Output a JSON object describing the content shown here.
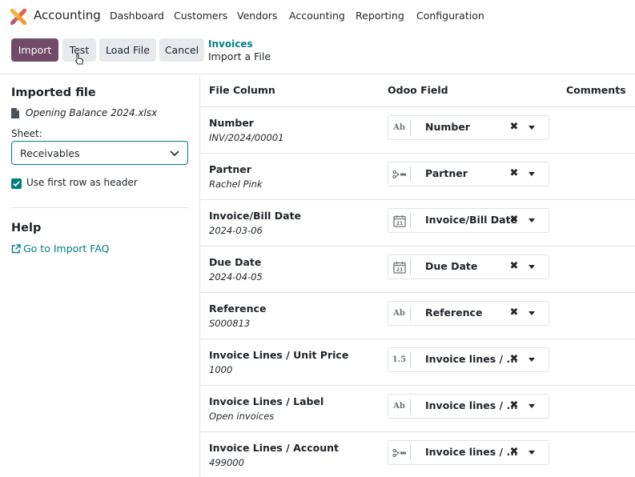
{
  "app": {
    "name": "Accounting",
    "logo_icon": "odoo-accounting-logo-icon"
  },
  "menu": [
    "Dashboard",
    "Customers",
    "Vendors",
    "Accounting",
    "Reporting",
    "Configuration"
  ],
  "toolbar": {
    "import_label": "Import",
    "test_label": "Test",
    "load_file_label": "Load File",
    "cancel_label": "Cancel"
  },
  "breadcrumb": {
    "parent": "Invoices",
    "current": "Import a File"
  },
  "sidebar": {
    "imported_file_title": "Imported file",
    "file_name": "Opening Balance 2024.xlsx",
    "sheet_label": "Sheet:",
    "sheet_value": "Receivables",
    "use_header_label": "Use first row as header",
    "use_header_checked": true,
    "help_title": "Help",
    "faq_link": "Go to Import FAQ"
  },
  "table": {
    "headers": {
      "file_column": "File Column",
      "odoo_field": "Odoo Field",
      "comments": "Comments"
    },
    "rows": [
      {
        "column": "Number",
        "sample": "INV/2024/00001",
        "field": "Number",
        "icon": "text-ab-icon",
        "icon_text": "Ab"
      },
      {
        "column": "Partner",
        "sample": "Rachel Pink",
        "field": "Partner",
        "icon": "relation-icon",
        "icon_text": ""
      },
      {
        "column": "Invoice/Bill Date",
        "sample": "2024-03-06",
        "field": "Invoice/Bill Date",
        "icon": "calendar-icon",
        "icon_text": "21"
      },
      {
        "column": "Due Date",
        "sample": "2024-04-05",
        "field": "Due Date",
        "icon": "calendar-icon",
        "icon_text": "21"
      },
      {
        "column": "Reference",
        "sample": "S000813",
        "field": "Reference",
        "icon": "text-ab-icon",
        "icon_text": "Ab"
      },
      {
        "column": "Invoice Lines / Unit Price",
        "sample": "1000",
        "field": "Invoice lines / ...",
        "icon": "float-icon",
        "icon_text": "1.5"
      },
      {
        "column": "Invoice Lines / Label",
        "sample": "Open invoices",
        "field": "Invoice lines / ...",
        "icon": "text-ab-icon",
        "icon_text": "Ab"
      },
      {
        "column": "Invoice Lines / Account",
        "sample": "499000",
        "field": "Invoice lines / ...",
        "icon": "relation-icon",
        "icon_text": ""
      }
    ]
  },
  "colors": {
    "primary": "#714b67",
    "accent": "#017e84",
    "secondary_button": "#e7e9ed"
  }
}
